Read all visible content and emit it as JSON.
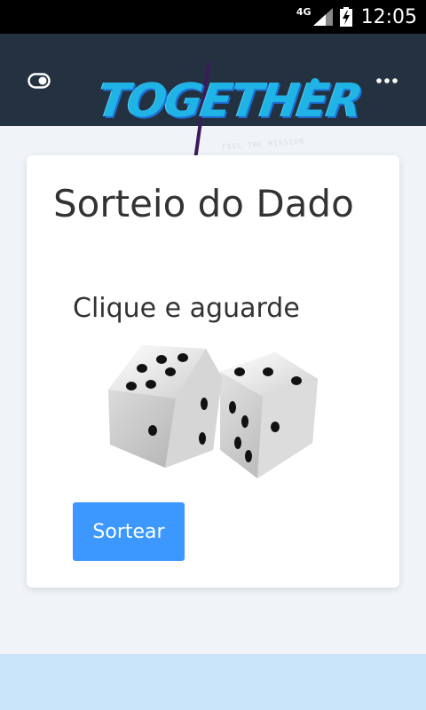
{
  "status_bar": {
    "network": "4G",
    "time": "12:05"
  },
  "header": {
    "logo_text": "TOGETHER",
    "logo_tagline": "FEEL THE MISSION",
    "left_icon": "toggle-icon",
    "right_icon": "more-icon"
  },
  "card": {
    "title": "Sorteio do Dado",
    "instruction": "Clique e aguarde",
    "button_label": "Sortear"
  },
  "colors": {
    "header_bg": "#243140",
    "button_bg": "#3c98ff",
    "page_bg": "#f0f4f8",
    "footer_bg": "#c9e4f9"
  }
}
